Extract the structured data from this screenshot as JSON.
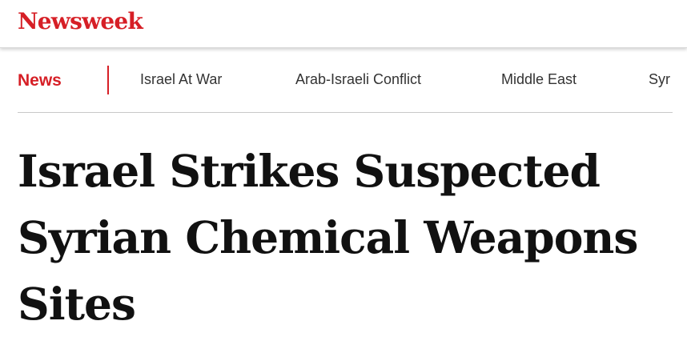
{
  "header": {
    "logo_text": "Newsweek"
  },
  "subnav": {
    "section_label": "News",
    "items": [
      {
        "label": "Israel At War"
      },
      {
        "label": "Arab-Israeli Conflict"
      },
      {
        "label": "Middle East"
      },
      {
        "label": "Syr"
      }
    ]
  },
  "article": {
    "headline": "Israel Strikes Suspected Syrian Chemical Weapons Sites"
  },
  "colors": {
    "brand_red": "#d61f26",
    "headline_text": "#111111",
    "nav_text": "#333333"
  }
}
